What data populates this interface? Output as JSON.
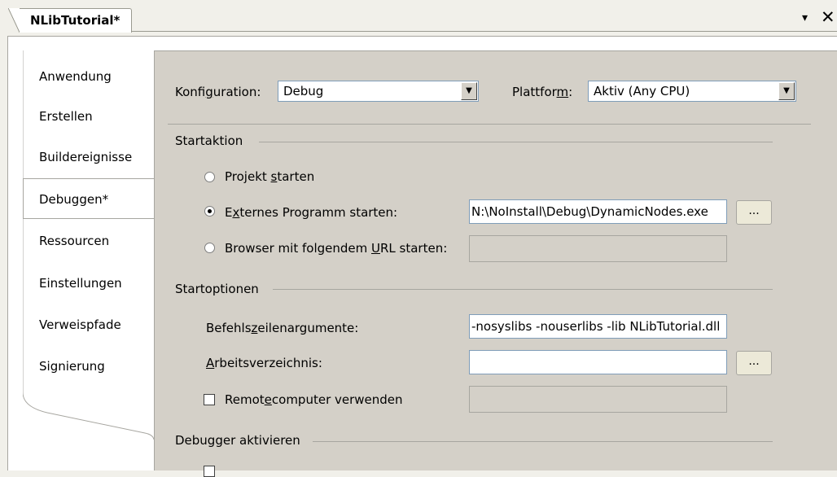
{
  "document_tab": {
    "title": "NLibTutorial*"
  },
  "window_controls": {
    "dropdown": "▾",
    "close": "✕"
  },
  "nav": {
    "items": [
      {
        "label": "Anwendung"
      },
      {
        "label": "Erstellen"
      },
      {
        "label": "Buildereignisse"
      },
      {
        "label": "Debuggen*"
      },
      {
        "label": "Ressourcen"
      },
      {
        "label": "Einstellungen"
      },
      {
        "label": "Verweispfade"
      },
      {
        "label": "Signierung"
      }
    ],
    "active": "Debuggen*"
  },
  "config": {
    "konfiguration_label_pre": "Konfi",
    "konfiguration_label_u": "g",
    "konfiguration_label_post": "uration:",
    "konfiguration_value": "Debug",
    "plattform_label_pre": "Plattfor",
    "plattform_label_u": "m",
    "plattform_label_post": ":",
    "plattform_value": "Aktiv (Any CPU)"
  },
  "startaktion": {
    "heading": "Startaktion",
    "projekt_pre": "Projekt ",
    "projekt_u": "s",
    "projekt_post": "tarten",
    "extern_pre": "E",
    "extern_u": "x",
    "extern_post": "ternes Programm starten:",
    "extern_value": "N:\\NoInstall\\Debug\\DynamicNodes.exe",
    "browser_pre": "Browser mit folgendem ",
    "browser_u": "U",
    "browser_post": "RL starten:",
    "browse_button": "...",
    "selected": "extern"
  },
  "startoptionen": {
    "heading": "Startoptionen",
    "args_pre": "Befehls",
    "args_u": "z",
    "args_post": "eilenargumente:",
    "args_value": "-nosyslibs -nouserlibs -lib NLibTutorial.dll",
    "workdir_pre": "",
    "workdir_u": "A",
    "workdir_post": "rbeitsverzeichnis:",
    "workdir_value": "",
    "browse_button": "...",
    "remote_pre": "Remot",
    "remote_u": "e",
    "remote_post": "computer verwenden",
    "remote_value": "",
    "remote_checked": false
  },
  "debugger": {
    "heading": "Debugger aktivieren"
  }
}
